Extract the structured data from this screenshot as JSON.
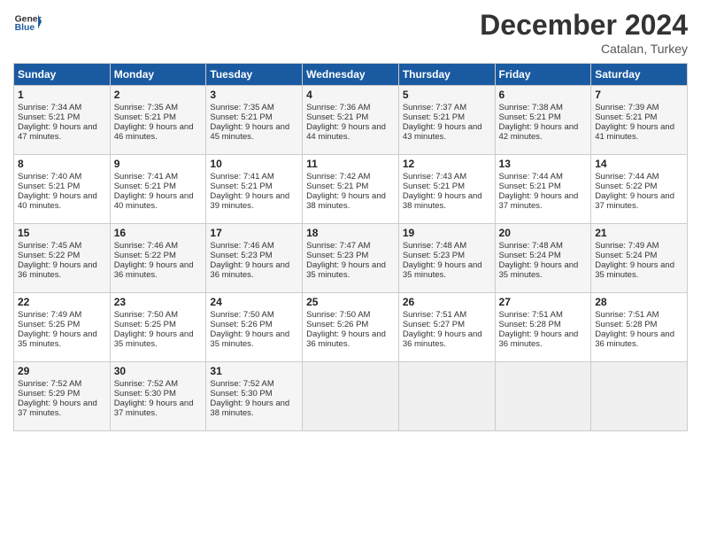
{
  "header": {
    "logo_general": "General",
    "logo_blue": "Blue",
    "month_title": "December 2024",
    "subtitle": "Catalan, Turkey"
  },
  "days_of_week": [
    "Sunday",
    "Monday",
    "Tuesday",
    "Wednesday",
    "Thursday",
    "Friday",
    "Saturday"
  ],
  "weeks": [
    [
      {
        "day": "1",
        "sunrise": "Sunrise: 7:34 AM",
        "sunset": "Sunset: 5:21 PM",
        "daylight": "Daylight: 9 hours and 47 minutes."
      },
      {
        "day": "2",
        "sunrise": "Sunrise: 7:35 AM",
        "sunset": "Sunset: 5:21 PM",
        "daylight": "Daylight: 9 hours and 46 minutes."
      },
      {
        "day": "3",
        "sunrise": "Sunrise: 7:35 AM",
        "sunset": "Sunset: 5:21 PM",
        "daylight": "Daylight: 9 hours and 45 minutes."
      },
      {
        "day": "4",
        "sunrise": "Sunrise: 7:36 AM",
        "sunset": "Sunset: 5:21 PM",
        "daylight": "Daylight: 9 hours and 44 minutes."
      },
      {
        "day": "5",
        "sunrise": "Sunrise: 7:37 AM",
        "sunset": "Sunset: 5:21 PM",
        "daylight": "Daylight: 9 hours and 43 minutes."
      },
      {
        "day": "6",
        "sunrise": "Sunrise: 7:38 AM",
        "sunset": "Sunset: 5:21 PM",
        "daylight": "Daylight: 9 hours and 42 minutes."
      },
      {
        "day": "7",
        "sunrise": "Sunrise: 7:39 AM",
        "sunset": "Sunset: 5:21 PM",
        "daylight": "Daylight: 9 hours and 41 minutes."
      }
    ],
    [
      {
        "day": "8",
        "sunrise": "Sunrise: 7:40 AM",
        "sunset": "Sunset: 5:21 PM",
        "daylight": "Daylight: 9 hours and 40 minutes."
      },
      {
        "day": "9",
        "sunrise": "Sunrise: 7:41 AM",
        "sunset": "Sunset: 5:21 PM",
        "daylight": "Daylight: 9 hours and 40 minutes."
      },
      {
        "day": "10",
        "sunrise": "Sunrise: 7:41 AM",
        "sunset": "Sunset: 5:21 PM",
        "daylight": "Daylight: 9 hours and 39 minutes."
      },
      {
        "day": "11",
        "sunrise": "Sunrise: 7:42 AM",
        "sunset": "Sunset: 5:21 PM",
        "daylight": "Daylight: 9 hours and 38 minutes."
      },
      {
        "day": "12",
        "sunrise": "Sunrise: 7:43 AM",
        "sunset": "Sunset: 5:21 PM",
        "daylight": "Daylight: 9 hours and 38 minutes."
      },
      {
        "day": "13",
        "sunrise": "Sunrise: 7:44 AM",
        "sunset": "Sunset: 5:21 PM",
        "daylight": "Daylight: 9 hours and 37 minutes."
      },
      {
        "day": "14",
        "sunrise": "Sunrise: 7:44 AM",
        "sunset": "Sunset: 5:22 PM",
        "daylight": "Daylight: 9 hours and 37 minutes."
      }
    ],
    [
      {
        "day": "15",
        "sunrise": "Sunrise: 7:45 AM",
        "sunset": "Sunset: 5:22 PM",
        "daylight": "Daylight: 9 hours and 36 minutes."
      },
      {
        "day": "16",
        "sunrise": "Sunrise: 7:46 AM",
        "sunset": "Sunset: 5:22 PM",
        "daylight": "Daylight: 9 hours and 36 minutes."
      },
      {
        "day": "17",
        "sunrise": "Sunrise: 7:46 AM",
        "sunset": "Sunset: 5:23 PM",
        "daylight": "Daylight: 9 hours and 36 minutes."
      },
      {
        "day": "18",
        "sunrise": "Sunrise: 7:47 AM",
        "sunset": "Sunset: 5:23 PM",
        "daylight": "Daylight: 9 hours and 35 minutes."
      },
      {
        "day": "19",
        "sunrise": "Sunrise: 7:48 AM",
        "sunset": "Sunset: 5:23 PM",
        "daylight": "Daylight: 9 hours and 35 minutes."
      },
      {
        "day": "20",
        "sunrise": "Sunrise: 7:48 AM",
        "sunset": "Sunset: 5:24 PM",
        "daylight": "Daylight: 9 hours and 35 minutes."
      },
      {
        "day": "21",
        "sunrise": "Sunrise: 7:49 AM",
        "sunset": "Sunset: 5:24 PM",
        "daylight": "Daylight: 9 hours and 35 minutes."
      }
    ],
    [
      {
        "day": "22",
        "sunrise": "Sunrise: 7:49 AM",
        "sunset": "Sunset: 5:25 PM",
        "daylight": "Daylight: 9 hours and 35 minutes."
      },
      {
        "day": "23",
        "sunrise": "Sunrise: 7:50 AM",
        "sunset": "Sunset: 5:25 PM",
        "daylight": "Daylight: 9 hours and 35 minutes."
      },
      {
        "day": "24",
        "sunrise": "Sunrise: 7:50 AM",
        "sunset": "Sunset: 5:26 PM",
        "daylight": "Daylight: 9 hours and 35 minutes."
      },
      {
        "day": "25",
        "sunrise": "Sunrise: 7:50 AM",
        "sunset": "Sunset: 5:26 PM",
        "daylight": "Daylight: 9 hours and 36 minutes."
      },
      {
        "day": "26",
        "sunrise": "Sunrise: 7:51 AM",
        "sunset": "Sunset: 5:27 PM",
        "daylight": "Daylight: 9 hours and 36 minutes."
      },
      {
        "day": "27",
        "sunrise": "Sunrise: 7:51 AM",
        "sunset": "Sunset: 5:28 PM",
        "daylight": "Daylight: 9 hours and 36 minutes."
      },
      {
        "day": "28",
        "sunrise": "Sunrise: 7:51 AM",
        "sunset": "Sunset: 5:28 PM",
        "daylight": "Daylight: 9 hours and 36 minutes."
      }
    ],
    [
      {
        "day": "29",
        "sunrise": "Sunrise: 7:52 AM",
        "sunset": "Sunset: 5:29 PM",
        "daylight": "Daylight: 9 hours and 37 minutes."
      },
      {
        "day": "30",
        "sunrise": "Sunrise: 7:52 AM",
        "sunset": "Sunset: 5:30 PM",
        "daylight": "Daylight: 9 hours and 37 minutes."
      },
      {
        "day": "31",
        "sunrise": "Sunrise: 7:52 AM",
        "sunset": "Sunset: 5:30 PM",
        "daylight": "Daylight: 9 hours and 38 minutes."
      },
      null,
      null,
      null,
      null
    ]
  ]
}
